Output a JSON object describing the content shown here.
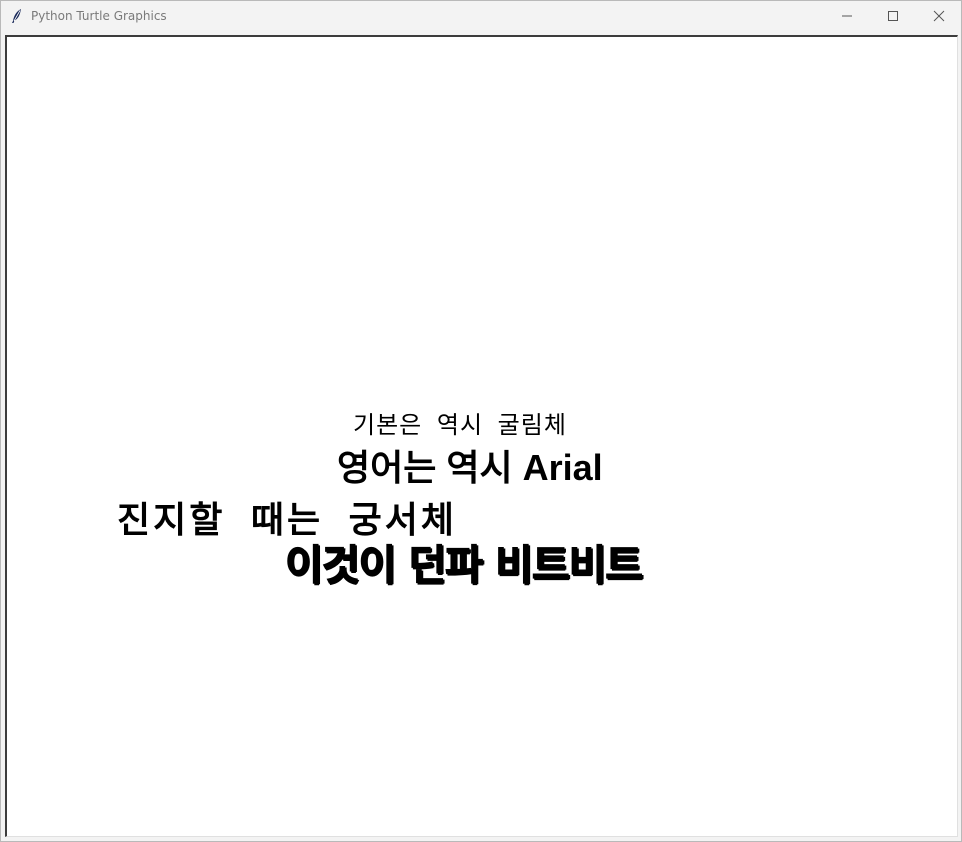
{
  "window": {
    "title": "Python Turtle Graphics",
    "icon": "feather-icon",
    "controls": {
      "minimize": "minimize-icon",
      "maximize": "maximize-icon",
      "close": "close-icon"
    }
  },
  "canvas": {
    "background": "#ffffff",
    "texts": [
      "기본은 역시 굴림체",
      "영어는 역시 Arial",
      "진지할 때는 궁서체",
      "이것이 던파 비트비트"
    ]
  },
  "colors": {
    "titlebar": "#f3f3f3",
    "title_text": "#7a7a7a",
    "text": "#000000"
  }
}
